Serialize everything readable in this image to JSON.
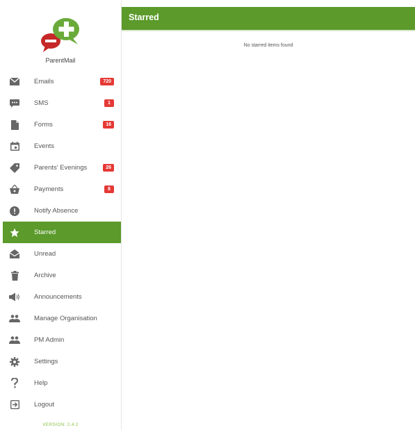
{
  "app": {
    "brand": "ParentMail",
    "version": "VERSION: 2.4.2"
  },
  "colors": {
    "accent": "#5b9a2b",
    "badge": "#e53935",
    "logo_green": "#6aaa3a",
    "logo_red": "#c62828"
  },
  "sidebar": {
    "items": [
      {
        "label": "Emails",
        "icon": "envelope-icon",
        "badge": "720"
      },
      {
        "label": "SMS",
        "icon": "sms-icon",
        "badge": "1"
      },
      {
        "label": "Forms",
        "icon": "document-icon",
        "badge": "16"
      },
      {
        "label": "Events",
        "icon": "calendar-icon",
        "badge": ""
      },
      {
        "label": "Parents' Evenings",
        "icon": "tag-icon",
        "badge": "26"
      },
      {
        "label": "Payments",
        "icon": "basket-icon",
        "badge": "8"
      },
      {
        "label": "Notify Absence",
        "icon": "alert-icon",
        "badge": ""
      },
      {
        "label": "Starred",
        "icon": "star-icon",
        "badge": "",
        "active": true
      },
      {
        "label": "Unread",
        "icon": "open-envelope-icon",
        "badge": ""
      },
      {
        "label": "Archive",
        "icon": "trash-icon",
        "badge": ""
      },
      {
        "label": "Announcements",
        "icon": "megaphone-icon",
        "badge": ""
      },
      {
        "label": "Manage Organisation",
        "icon": "people-icon",
        "badge": ""
      },
      {
        "label": "PM Admin",
        "icon": "people-icon",
        "badge": ""
      },
      {
        "label": "Settings",
        "icon": "gear-icon",
        "badge": ""
      },
      {
        "label": "Help",
        "icon": "help-icon",
        "badge": ""
      },
      {
        "label": "Logout",
        "icon": "logout-icon",
        "badge": ""
      }
    ]
  },
  "header": {
    "title": "Starred"
  },
  "main": {
    "empty_message": "No starred items found"
  }
}
